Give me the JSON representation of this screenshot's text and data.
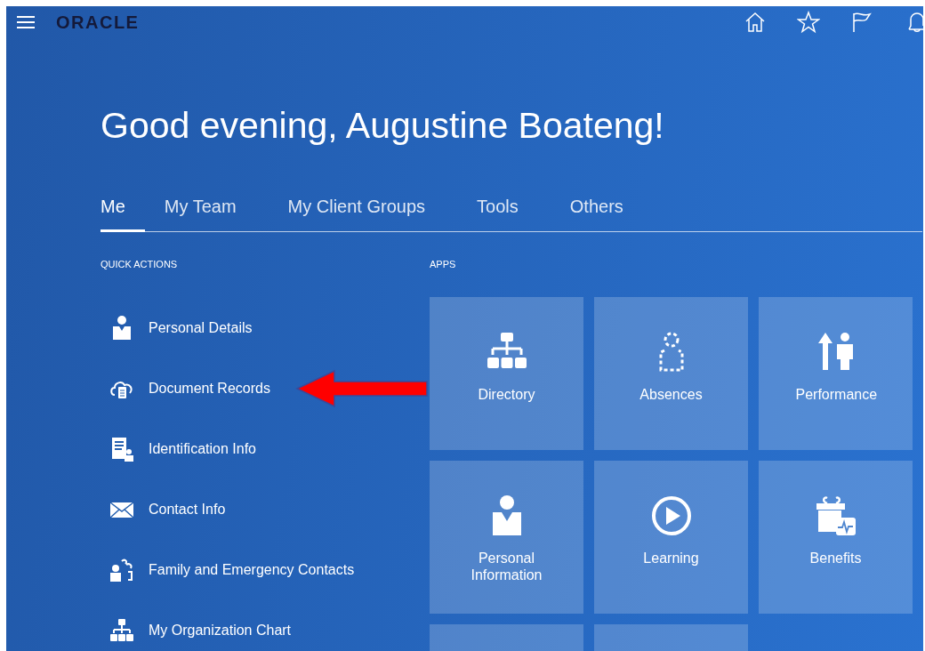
{
  "header": {
    "logo": "ORACLE"
  },
  "greeting": "Good evening, Augustine Boateng!",
  "tabs": [
    {
      "label": "Me",
      "selected": true
    },
    {
      "label": "My Team",
      "selected": false
    },
    {
      "label": "My Client Groups",
      "selected": false
    },
    {
      "label": "Tools",
      "selected": false
    },
    {
      "label": "Others",
      "selected": false
    }
  ],
  "quick_actions": {
    "title": "QUICK ACTIONS",
    "items": [
      {
        "kind": "person",
        "label": "Personal Details",
        "pointed": false
      },
      {
        "kind": "cloud",
        "label": "Document Records",
        "pointed": true
      },
      {
        "kind": "idcard",
        "label": "Identification Info",
        "pointed": false
      },
      {
        "kind": "mail",
        "label": "Contact Info",
        "pointed": false
      },
      {
        "kind": "family",
        "label": "Family and Emergency Contacts",
        "pointed": false
      },
      {
        "kind": "org",
        "label": "My Organization Chart",
        "pointed": false
      }
    ]
  },
  "apps": {
    "title": "APPS",
    "tiles": [
      {
        "kind": "org",
        "label": "Directory"
      },
      {
        "kind": "absence",
        "label": "Absences"
      },
      {
        "kind": "performance",
        "label": "Performance"
      },
      {
        "kind": "person",
        "label": "Personal Information"
      },
      {
        "kind": "play",
        "label": "Learning"
      },
      {
        "kind": "gift",
        "label": "Benefits"
      },
      {
        "kind": "partial"
      },
      {
        "kind": "partial"
      }
    ]
  }
}
